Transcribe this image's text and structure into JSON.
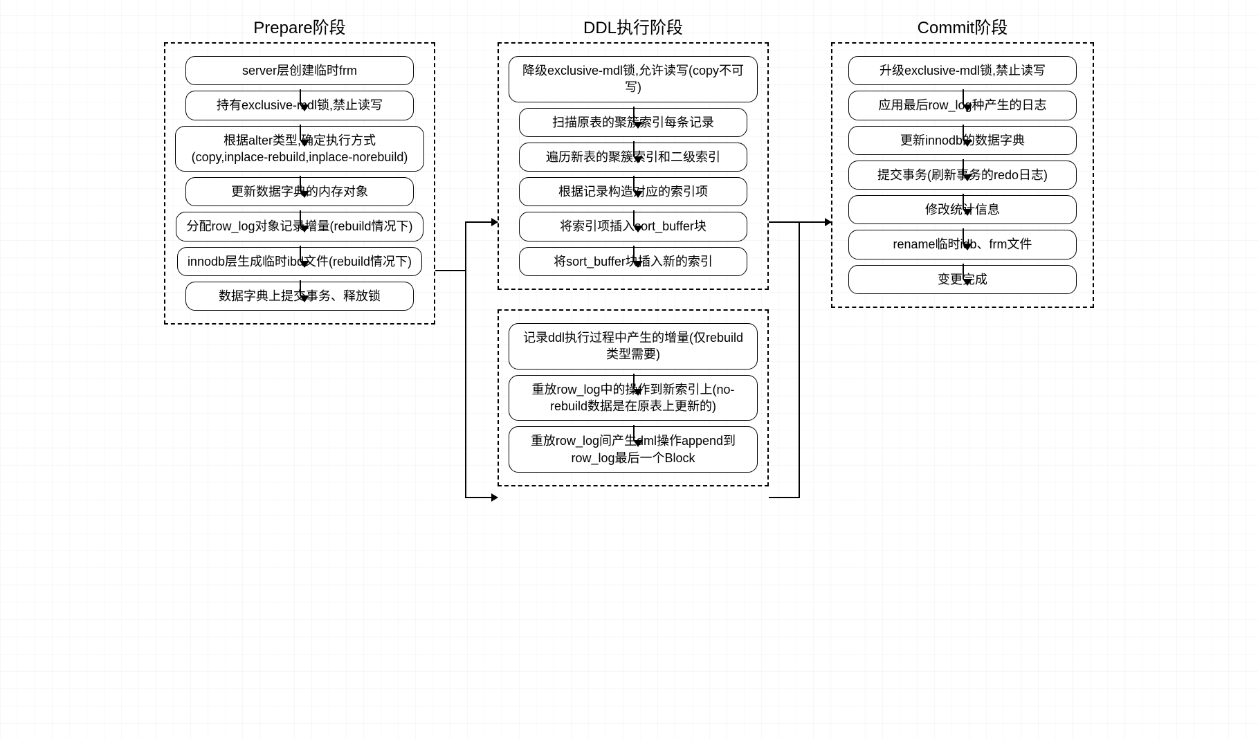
{
  "phases": {
    "prepare": {
      "title": "Prepare阶段",
      "steps": [
        "server层创建临时frm",
        "持有exclusive-mdl锁,禁止读写",
        "根据alter类型,确定执行方式(copy,inplace-rebuild,inplace-norebuild)",
        "更新数据字典的内存对象",
        "分配row_log对象记录增量(rebuild情况下)",
        "innodb层生成临时ibd文件(rebuild情况下)",
        "数据字典上提交事务、释放锁"
      ]
    },
    "ddl": {
      "title": "DDL执行阶段",
      "upper_steps": [
        "降级exclusive-mdl锁,允许读写(copy不可写)",
        "扫描原表的聚簇索引每条记录",
        "遍历新表的聚簇索引和二级索引",
        "根据记录构造对应的索引项",
        "将索引项插入sort_buffer块",
        "将sort_buffer块插入新的索引"
      ],
      "lower_steps": [
        "记录ddl执行过程中产生的增量(仅rebuild类型需要)",
        "重放row_log中的操作到新索引上(no-rebuild数据是在原表上更新的)",
        "重放row_log间产生dml操作append到row_log最后一个Block"
      ]
    },
    "commit": {
      "title": "Commit阶段",
      "steps": [
        "升级exclusive-mdl锁,禁止读写",
        "应用最后row_log种产生的日志",
        "更新innodb的数据字典",
        "提交事务(刷新事务的redo日志)",
        "修改统计信息",
        "rename临时idb、frm文件",
        "变更完成"
      ]
    }
  }
}
